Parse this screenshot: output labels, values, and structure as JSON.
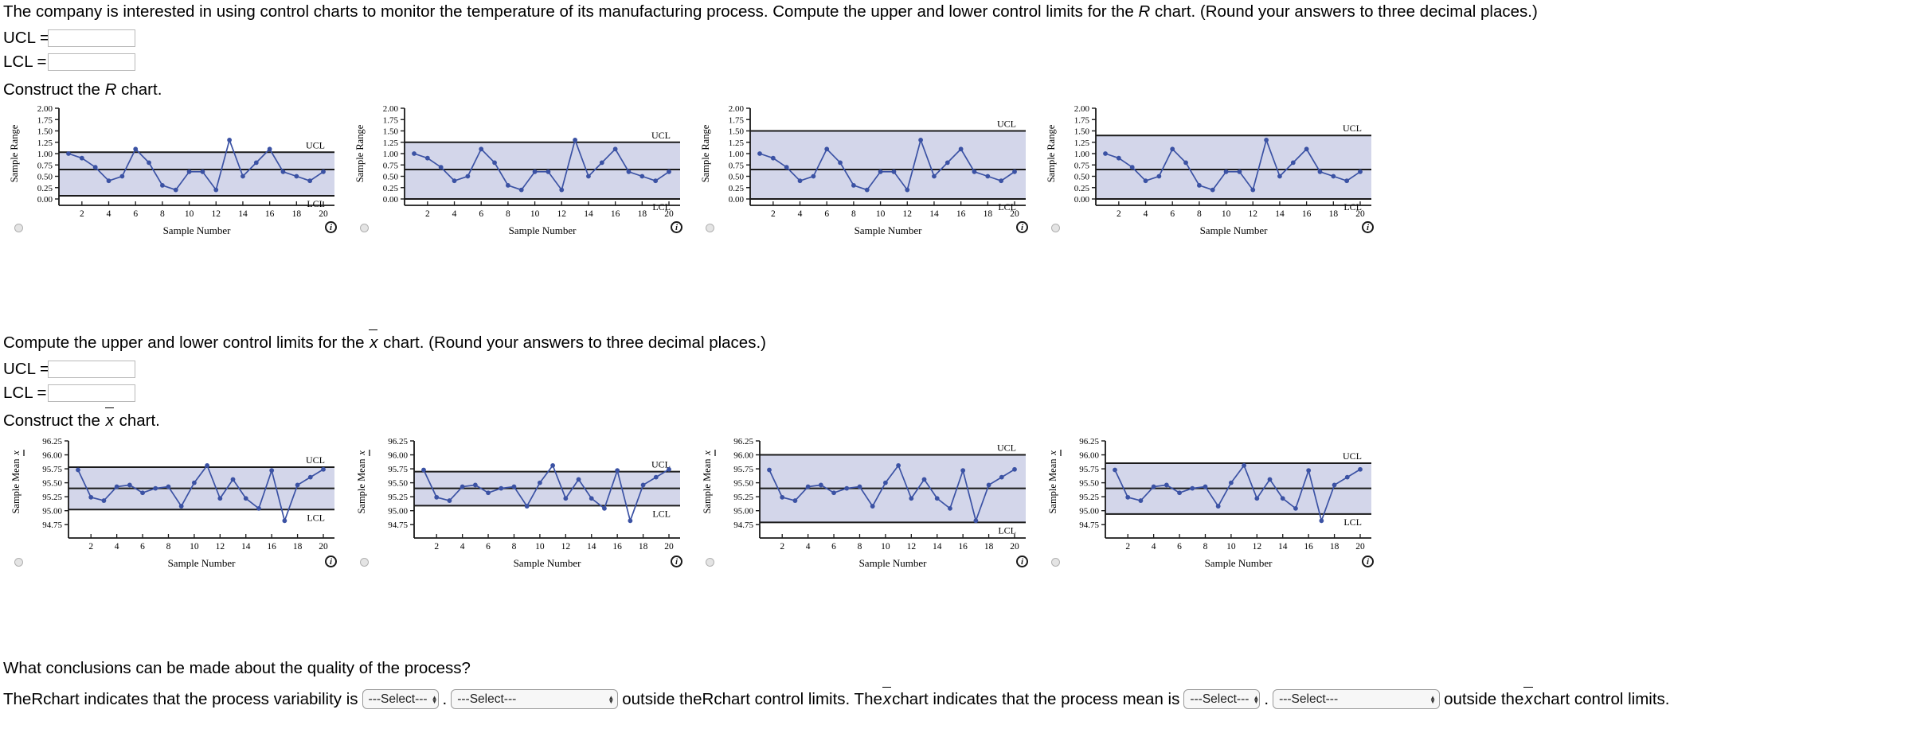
{
  "prompt": {
    "intro_1": "The company is interested in using control charts to monitor the temperature of its manufacturing process. Compute the upper and lower control limits for the ",
    "intro_r_sym": "R",
    "intro_2": " chart. (Round your answers to three decimal places.)",
    "ucl_label": "UCL  =",
    "lcl_label": "LCL  =",
    "construct_r_pre": "Construct the ",
    "construct_r_sym": "R",
    "construct_r_post": " chart.",
    "xbar_compute_pre": "Compute the upper and lower control limits for the ",
    "xbar_sym": "x",
    "xbar_compute_post": " chart. (Round your answers to three decimal places.)",
    "construct_x_pre": "Construct the ",
    "construct_x_post": " chart.",
    "conclusion_question": "What conclusions can be made about the quality of the process?",
    "concl_1": "The ",
    "concl_r_sym": "R",
    "concl_2": " chart indicates that the process variability is",
    "concl_period": ".",
    "concl_3": "outside the ",
    "concl_r_sym2": "R",
    "concl_4": " chart control limits. The ",
    "concl_5": " chart indicates that the process mean is",
    "concl_6": "outside the ",
    "concl_7": " chart control limits."
  },
  "inputs": {
    "r_ucl_value": "",
    "r_lcl_value": "",
    "x_ucl_value": "",
    "x_lcl_value": "",
    "placeholder": ""
  },
  "selects": {
    "default_option": "---Select---",
    "s1": "---Select---",
    "s2": "---Select---",
    "s3": "---Select---",
    "s4": "---Select---"
  },
  "colors": {
    "marker": "#3b52a4",
    "line": "#3b52a4",
    "band": "#d3d6ea",
    "limit_line": "#1a1a1a",
    "axis": "#1a1a1a",
    "text": "#000000"
  },
  "chart_data": [
    {
      "id": "r-chart-option-1",
      "type": "line",
      "title": "",
      "xlabel": "Sample Number",
      "ylabel": "Sample Range",
      "x": [
        1,
        2,
        3,
        4,
        5,
        6,
        7,
        8,
        9,
        10,
        11,
        12,
        13,
        14,
        15,
        16,
        17,
        18,
        19,
        20
      ],
      "values": [
        1.0,
        0.9,
        0.7,
        0.4,
        0.5,
        1.1,
        0.8,
        0.3,
        0.2,
        0.6,
        0.6,
        0.2,
        1.3,
        0.5,
        0.8,
        1.1,
        0.6,
        0.5,
        0.4,
        0.6
      ],
      "ylim": [
        0.0,
        2.0
      ],
      "yticks": [
        "0.00",
        "0.25",
        "0.50",
        "0.75",
        "1.00",
        "1.25",
        "1.50",
        "1.75",
        "2.00"
      ],
      "xticks": [
        "2",
        "4",
        "6",
        "8",
        "10",
        "12",
        "14",
        "16",
        "18",
        "20"
      ],
      "ucl": 1.03,
      "center": 0.65,
      "lcl": 0.07,
      "ucl_label": "UCL",
      "lcl_label": "LCL",
      "grid": false,
      "legend": "none"
    },
    {
      "id": "r-chart-option-2",
      "type": "line",
      "title": "",
      "xlabel": "Sample Number",
      "ylabel": "Sample Range",
      "x": [
        1,
        2,
        3,
        4,
        5,
        6,
        7,
        8,
        9,
        10,
        11,
        12,
        13,
        14,
        15,
        16,
        17,
        18,
        19,
        20
      ],
      "values": [
        1.0,
        0.9,
        0.7,
        0.4,
        0.5,
        1.1,
        0.8,
        0.3,
        0.2,
        0.6,
        0.6,
        0.2,
        1.3,
        0.5,
        0.8,
        1.1,
        0.6,
        0.5,
        0.4,
        0.6
      ],
      "ylim": [
        0.0,
        2.0
      ],
      "yticks": [
        "0.00",
        "0.25",
        "0.50",
        "0.75",
        "1.00",
        "1.25",
        "1.50",
        "1.75",
        "2.00"
      ],
      "xticks": [
        "2",
        "4",
        "6",
        "8",
        "10",
        "12",
        "14",
        "16",
        "18",
        "20"
      ],
      "ucl": 1.25,
      "center": 0.65,
      "lcl": 0.0,
      "ucl_label": "UCL",
      "lcl_label": "LCL",
      "grid": false,
      "legend": "none"
    },
    {
      "id": "r-chart-option-3",
      "type": "line",
      "title": "",
      "xlabel": "Sample Number",
      "ylabel": "Sample Range",
      "x": [
        1,
        2,
        3,
        4,
        5,
        6,
        7,
        8,
        9,
        10,
        11,
        12,
        13,
        14,
        15,
        16,
        17,
        18,
        19,
        20
      ],
      "values": [
        1.0,
        0.9,
        0.7,
        0.4,
        0.5,
        1.1,
        0.8,
        0.3,
        0.2,
        0.6,
        0.6,
        0.2,
        1.3,
        0.5,
        0.8,
        1.1,
        0.6,
        0.5,
        0.4,
        0.6
      ],
      "ylim": [
        0.0,
        2.0
      ],
      "yticks": [
        "0.00",
        "0.25",
        "0.50",
        "0.75",
        "1.00",
        "1.25",
        "1.50",
        "1.75",
        "2.00"
      ],
      "xticks": [
        "2",
        "4",
        "6",
        "8",
        "10",
        "12",
        "14",
        "16",
        "18",
        "20"
      ],
      "ucl": 1.5,
      "center": 0.65,
      "lcl": 0.0,
      "ucl_label": "UCL",
      "lcl_label": "LCL",
      "grid": false,
      "legend": "none"
    },
    {
      "id": "r-chart-option-4",
      "type": "line",
      "title": "",
      "xlabel": "Sample Number",
      "ylabel": "Sample Range",
      "x": [
        1,
        2,
        3,
        4,
        5,
        6,
        7,
        8,
        9,
        10,
        11,
        12,
        13,
        14,
        15,
        16,
        17,
        18,
        19,
        20
      ],
      "values": [
        1.0,
        0.9,
        0.7,
        0.4,
        0.5,
        1.1,
        0.8,
        0.3,
        0.2,
        0.6,
        0.6,
        0.2,
        1.3,
        0.5,
        0.8,
        1.1,
        0.6,
        0.5,
        0.4,
        0.6
      ],
      "ylim": [
        0.0,
        2.0
      ],
      "yticks": [
        "0.00",
        "0.25",
        "0.50",
        "0.75",
        "1.00",
        "1.25",
        "1.50",
        "1.75",
        "2.00"
      ],
      "xticks": [
        "2",
        "4",
        "6",
        "8",
        "10",
        "12",
        "14",
        "16",
        "18",
        "20"
      ],
      "ucl": 1.4,
      "center": 0.65,
      "lcl": 0.0,
      "ucl_label": "UCL",
      "lcl_label": "LCL",
      "grid": false,
      "legend": "none"
    },
    {
      "id": "xbar-chart-option-1",
      "type": "line",
      "title": "",
      "xlabel": "Sample Number",
      "ylabel": "Sample Mean x",
      "x": [
        1,
        2,
        3,
        4,
        5,
        6,
        7,
        8,
        9,
        10,
        11,
        12,
        13,
        14,
        15,
        16,
        17,
        18,
        19,
        20
      ],
      "values": [
        95.73,
        95.24,
        95.18,
        95.43,
        95.46,
        95.32,
        95.4,
        95.43,
        95.08,
        95.5,
        95.81,
        95.22,
        95.56,
        95.22,
        95.04,
        95.72,
        94.82,
        95.46,
        95.6,
        95.74
      ],
      "ylim": [
        94.625,
        96.25
      ],
      "yticks": [
        "94.75",
        "95.00",
        "95.25",
        "95.50",
        "95.75",
        "96.00",
        "96.25"
      ],
      "xticks": [
        "2",
        "4",
        "6",
        "8",
        "10",
        "12",
        "14",
        "16",
        "18",
        "20"
      ],
      "ucl": 95.78,
      "center": 95.4,
      "lcl": 95.02,
      "ucl_label": "UCL",
      "lcl_label": "LCL",
      "grid": false,
      "legend": "none"
    },
    {
      "id": "xbar-chart-option-2",
      "type": "line",
      "title": "",
      "xlabel": "Sample Number",
      "ylabel": "Sample Mean x",
      "x": [
        1,
        2,
        3,
        4,
        5,
        6,
        7,
        8,
        9,
        10,
        11,
        12,
        13,
        14,
        15,
        16,
        17,
        18,
        19,
        20
      ],
      "values": [
        95.73,
        95.24,
        95.18,
        95.43,
        95.46,
        95.32,
        95.4,
        95.43,
        95.08,
        95.5,
        95.81,
        95.22,
        95.56,
        95.22,
        95.04,
        95.72,
        94.82,
        95.46,
        95.6,
        95.74
      ],
      "ylim": [
        94.625,
        96.25
      ],
      "yticks": [
        "94.75",
        "95.00",
        "95.25",
        "95.50",
        "95.75",
        "96.00",
        "96.25"
      ],
      "xticks": [
        "2",
        "4",
        "6",
        "8",
        "10",
        "12",
        "14",
        "16",
        "18",
        "20"
      ],
      "ucl": 95.7,
      "center": 95.4,
      "lcl": 95.09,
      "ucl_label": "UCL",
      "lcl_label": "LCL",
      "grid": false,
      "legend": "none"
    },
    {
      "id": "xbar-chart-option-3",
      "type": "line",
      "title": "",
      "xlabel": "Sample Number",
      "ylabel": "Sample Mean x",
      "x": [
        1,
        2,
        3,
        4,
        5,
        6,
        7,
        8,
        9,
        10,
        11,
        12,
        13,
        14,
        15,
        16,
        17,
        18,
        19,
        20
      ],
      "values": [
        95.73,
        95.24,
        95.18,
        95.43,
        95.46,
        95.32,
        95.4,
        95.43,
        95.08,
        95.5,
        95.81,
        95.22,
        95.56,
        95.22,
        95.04,
        95.72,
        94.82,
        95.46,
        95.6,
        95.74
      ],
      "ylim": [
        94.625,
        96.25
      ],
      "yticks": [
        "94.75",
        "95.00",
        "95.25",
        "95.50",
        "95.75",
        "96.00",
        "96.25"
      ],
      "xticks": [
        "2",
        "4",
        "6",
        "8",
        "10",
        "12",
        "14",
        "16",
        "18",
        "20"
      ],
      "ucl": 96.0,
      "center": 95.4,
      "lcl": 94.79,
      "ucl_label": "UCL",
      "lcl_label": "LCL",
      "grid": false,
      "legend": "none"
    },
    {
      "id": "xbar-chart-option-4",
      "type": "line",
      "title": "",
      "xlabel": "Sample Number",
      "ylabel": "Sample Mean x",
      "x": [
        1,
        2,
        3,
        4,
        5,
        6,
        7,
        8,
        9,
        10,
        11,
        12,
        13,
        14,
        15,
        16,
        17,
        18,
        19,
        20
      ],
      "values": [
        95.73,
        95.24,
        95.18,
        95.43,
        95.46,
        95.32,
        95.4,
        95.43,
        95.08,
        95.5,
        95.81,
        95.22,
        95.56,
        95.22,
        95.04,
        95.72,
        94.82,
        95.46,
        95.6,
        95.74
      ],
      "ylim": [
        94.625,
        96.25
      ],
      "yticks": [
        "94.75",
        "95.00",
        "95.25",
        "95.50",
        "95.75",
        "96.00",
        "96.25"
      ],
      "xticks": [
        "2",
        "4",
        "6",
        "8",
        "10",
        "12",
        "14",
        "16",
        "18",
        "20"
      ],
      "ucl": 95.85,
      "center": 95.4,
      "lcl": 94.94,
      "ucl_label": "UCL",
      "lcl_label": "LCL",
      "grid": false,
      "legend": "none"
    }
  ]
}
